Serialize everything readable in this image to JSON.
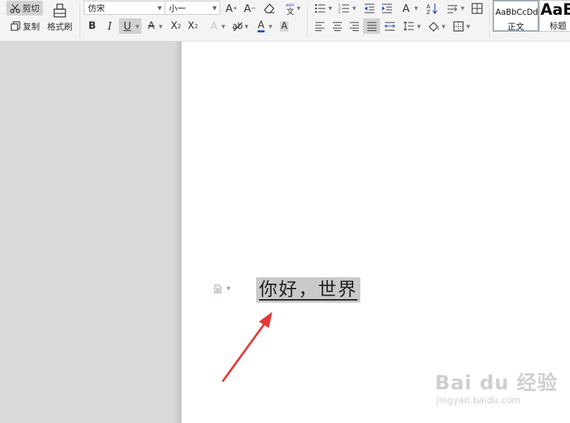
{
  "clipboard": {
    "cut_label": "剪切",
    "copy_label": "复制",
    "format_painter_label": "格式刷"
  },
  "font": {
    "font_name": "仿宋",
    "font_size": "小一"
  },
  "styles": {
    "normal_preview": "AaBbCcDd",
    "normal_label": "正文",
    "heading_preview": "AaB",
    "heading_label": "标题"
  },
  "document": {
    "selected_text": "你好，世界"
  },
  "watermark": {
    "brand": "Bai du 经验",
    "url": "jingyan.baidu.com"
  },
  "colors": {
    "accent_font_color": "#2a50c8",
    "selection_bg": "#c9c9c9",
    "annotation_arrow": "#e53935"
  }
}
